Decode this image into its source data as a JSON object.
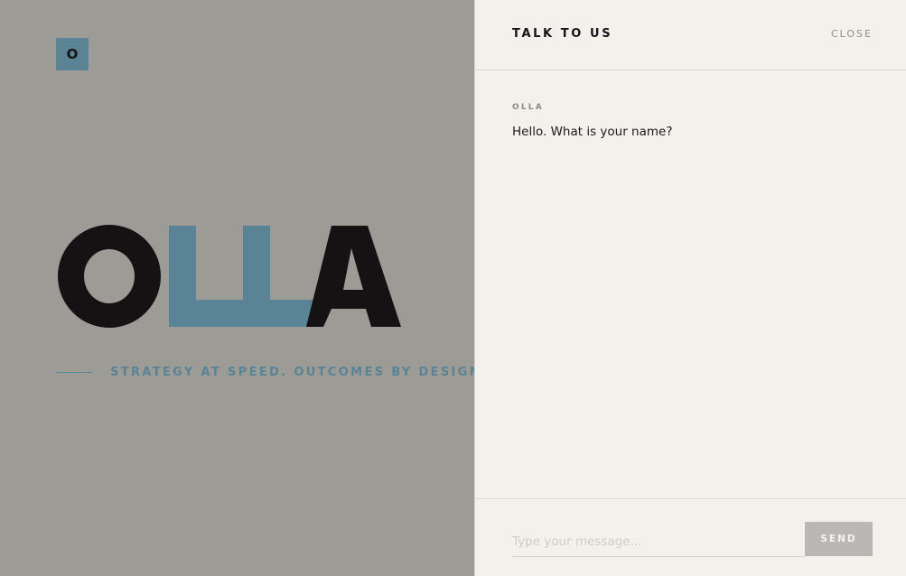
{
  "brand": {
    "badge_letter": "O",
    "wordmark": "OLLA",
    "tagline": "STRATEGY AT SPEED. OUTCOMES BY DESIGN.",
    "colors": {
      "accent": "#5a8496",
      "ink": "#141213",
      "backdrop": "#9c9b96",
      "panel": "#f4f1ec"
    }
  },
  "chat": {
    "title": "TALK TO US",
    "close_label": "CLOSE",
    "messages": [
      {
        "sender": "OLLA",
        "text": "Hello. What is your name?"
      }
    ],
    "input": {
      "placeholder": "Type your message...",
      "value": ""
    },
    "send_label": "SEND"
  }
}
